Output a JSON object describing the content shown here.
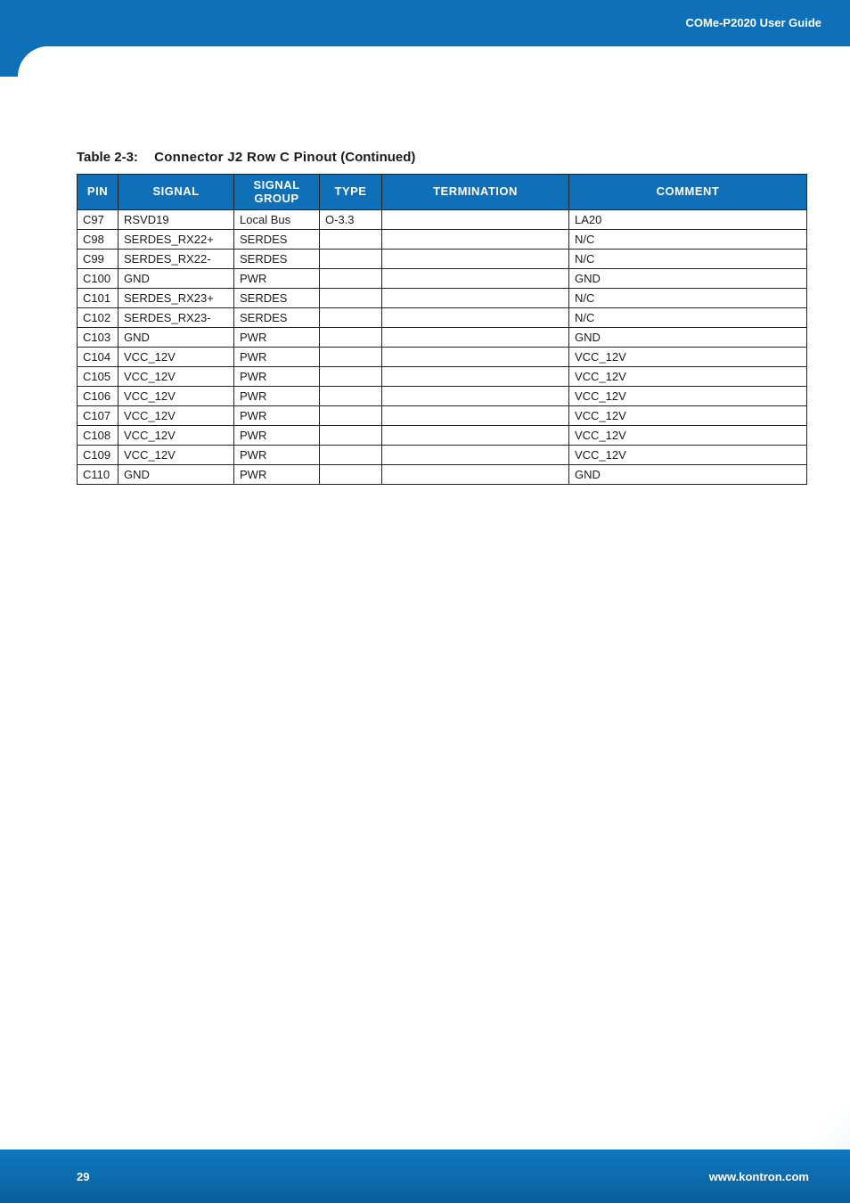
{
  "header": {
    "guide_label": "COMe-P2020 User Guide"
  },
  "table": {
    "caption_number": "Table 2-3:",
    "caption_title": "Connector J2 Row C Pinout",
    "caption_continued": "(Continued)",
    "columns": {
      "pin": "PIN",
      "signal": "SIGNAL",
      "group_line1": "SIGNAL",
      "group_line2": "GROUP",
      "type": "TYPE",
      "termination": "TERMINATION",
      "comment": "COMMENT"
    },
    "rows": [
      {
        "pin": "C97",
        "signal": "RSVD19",
        "group": "Local Bus",
        "type": "O-3.3",
        "termination": "",
        "comment": "LA20"
      },
      {
        "pin": "C98",
        "signal": "SERDES_RX22+",
        "group": "SERDES",
        "type": "",
        "termination": "",
        "comment": "N/C"
      },
      {
        "pin": "C99",
        "signal": "SERDES_RX22-",
        "group": "SERDES",
        "type": "",
        "termination": "",
        "comment": "N/C"
      },
      {
        "pin": "C100",
        "signal": "GND",
        "group": "PWR",
        "type": "",
        "termination": "",
        "comment": "GND"
      },
      {
        "pin": "C101",
        "signal": "SERDES_RX23+",
        "group": "SERDES",
        "type": "",
        "termination": "",
        "comment": "N/C"
      },
      {
        "pin": "C102",
        "signal": "SERDES_RX23-",
        "group": "SERDES",
        "type": "",
        "termination": "",
        "comment": "N/C"
      },
      {
        "pin": "C103",
        "signal": "GND",
        "group": "PWR",
        "type": "",
        "termination": "",
        "comment": "GND"
      },
      {
        "pin": "C104",
        "signal": "VCC_12V",
        "group": "PWR",
        "type": "",
        "termination": "",
        "comment": "VCC_12V"
      },
      {
        "pin": "C105",
        "signal": "VCC_12V",
        "group": "PWR",
        "type": "",
        "termination": "",
        "comment": "VCC_12V"
      },
      {
        "pin": "C106",
        "signal": "VCC_12V",
        "group": "PWR",
        "type": "",
        "termination": "",
        "comment": "VCC_12V"
      },
      {
        "pin": "C107",
        "signal": "VCC_12V",
        "group": "PWR",
        "type": "",
        "termination": "",
        "comment": "VCC_12V"
      },
      {
        "pin": "C108",
        "signal": "VCC_12V",
        "group": "PWR",
        "type": "",
        "termination": "",
        "comment": "VCC_12V"
      },
      {
        "pin": "C109",
        "signal": "VCC_12V",
        "group": "PWR",
        "type": "",
        "termination": "",
        "comment": "VCC_12V"
      },
      {
        "pin": "C110",
        "signal": "GND",
        "group": "PWR",
        "type": "",
        "termination": "",
        "comment": "GND"
      }
    ]
  },
  "footer": {
    "page_number": "29",
    "site": "www.kontron.com"
  }
}
